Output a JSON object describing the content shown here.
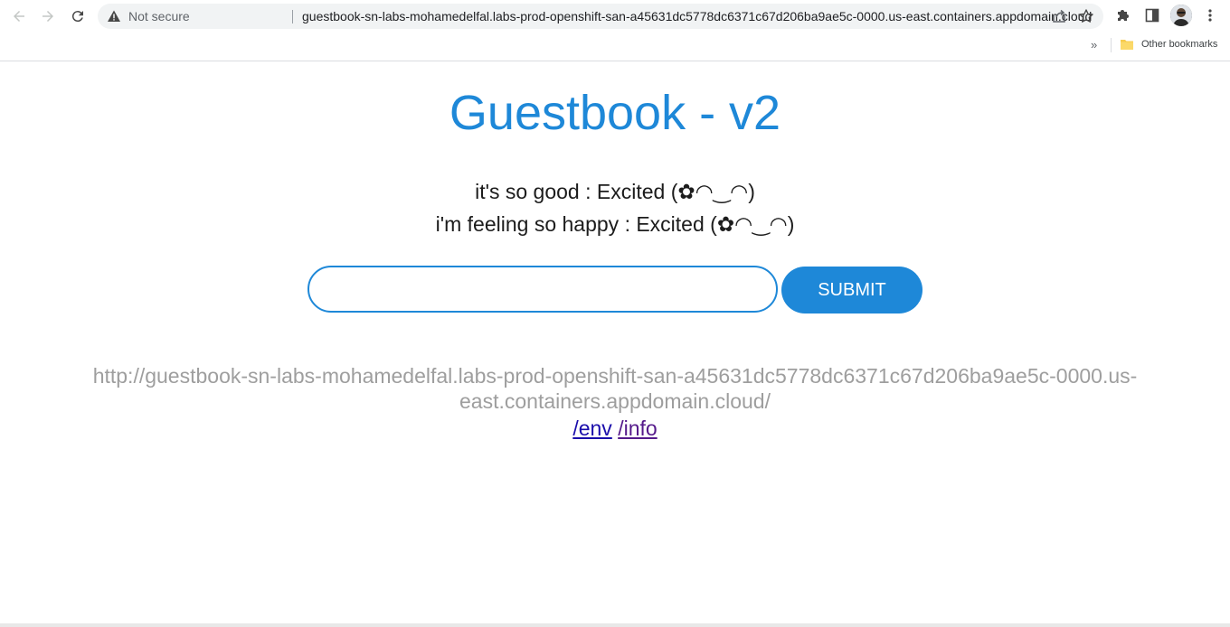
{
  "browser": {
    "security_label": "Not secure",
    "url": "guestbook-sn-labs-mohamedelfal.labs-prod-openshift-san-a45631dc5778dc6371c67d206ba9ae5c-0000.us-east.containers.appdomain.cloud",
    "bookmarks_overflow": "»",
    "bookmark_folder": "Other bookmarks"
  },
  "page": {
    "title": "Guestbook - v2",
    "entries": [
      "it's so good : Excited (✿◠‿◠)",
      "i'm feeling so happy : Excited (✿◠‿◠)"
    ],
    "input_value": "",
    "submit_label": "SUBMIT",
    "host": "http://guestbook-sn-labs-mohamedelfal.labs-prod-openshift-san-a45631dc5778dc6371c67d206ba9ae5c-0000.us-east.containers.appdomain.cloud/",
    "links": [
      {
        "label": "/env"
      },
      {
        "label": "/info"
      }
    ]
  },
  "colors": {
    "accent": "#1e88d8",
    "link": "#1a0dab",
    "visited_link": "#551a8b",
    "host_text": "#9e9e9e"
  },
  "icons": [
    "back-arrow-icon",
    "forward-arrow-icon",
    "reload-icon",
    "warning-icon",
    "share-icon",
    "star-icon",
    "extensions-icon",
    "side-panel-icon",
    "kebab-menu-icon",
    "folder-icon"
  ]
}
